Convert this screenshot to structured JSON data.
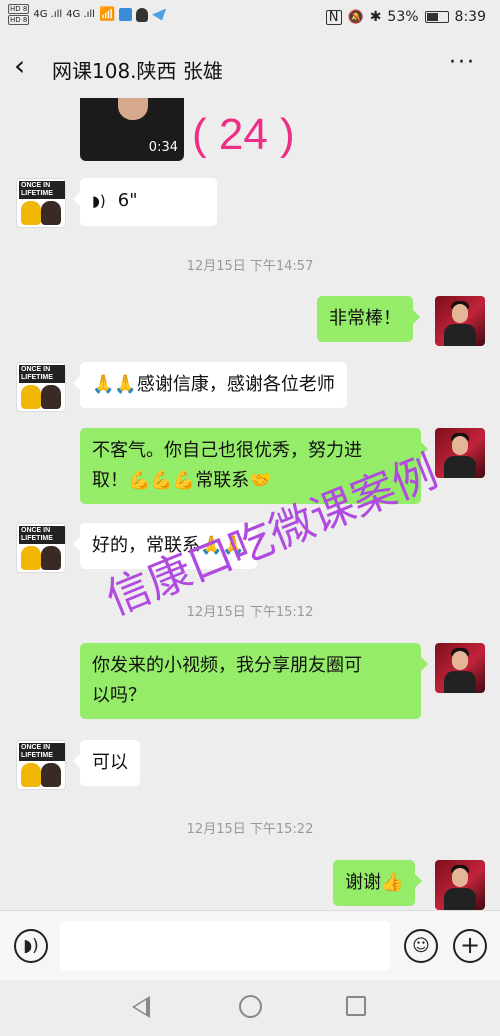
{
  "status_bar": {
    "hd1": "HD 8",
    "hd2": "HD 8",
    "signal1": "4G .ıll",
    "signal2": "4G .ıll",
    "battery": "53%",
    "time": "8:39"
  },
  "header": {
    "back_icon": "‹",
    "title": "网课108.陕西 张雄",
    "more_icon": "···"
  },
  "video_message": {
    "duration": "0:34",
    "annotation": "( 24 )"
  },
  "messages": [
    {
      "id": "m1",
      "side": "in",
      "type": "voice",
      "duration": "6\""
    },
    {
      "id": "t1",
      "type": "timestamp",
      "text": "12月15日 下午14:57"
    },
    {
      "id": "m2",
      "side": "out",
      "text": "非常棒！"
    },
    {
      "id": "m3",
      "side": "in",
      "emoji": "🙏🙏",
      "text": "感谢信康，感谢各位老师"
    },
    {
      "id": "m4",
      "side": "out",
      "line1": "不客气。你自己也很优秀，努力进",
      "line2_prefix": "取！",
      "line2_emoji": "💪💪💪",
      "line2_text": "常联系",
      "line2_emoji2": "🤝"
    },
    {
      "id": "m5",
      "side": "in",
      "text": "好的，常联系",
      "emoji": "🙏🙏"
    },
    {
      "id": "t2",
      "type": "timestamp",
      "text": "12月15日 下午15:12"
    },
    {
      "id": "m6",
      "side": "out",
      "line1": "你发来的小视频，我分享朋友圈可",
      "line2": "以吗？"
    },
    {
      "id": "m7",
      "side": "in",
      "text": "可以"
    },
    {
      "id": "t3",
      "type": "timestamp",
      "text": "12月15日 下午15:22"
    },
    {
      "id": "m8",
      "side": "out",
      "text": "谢谢",
      "emoji": "👍"
    }
  ],
  "avatars": {
    "friend_badge": "ONCE IN LIFETIME"
  },
  "watermark": "信康口吃微课案例",
  "input_bar": {
    "voice_icon": "voice-icon",
    "emoji_icon": "emoji-icon",
    "plus_icon": "plus-icon",
    "placeholder": ""
  },
  "colors": {
    "outgoing_bubble": "#95ec69",
    "incoming_bubble": "#ffffff",
    "background": "#ededed",
    "annotation": "#ee2d86",
    "watermark": "#b04ae0"
  }
}
